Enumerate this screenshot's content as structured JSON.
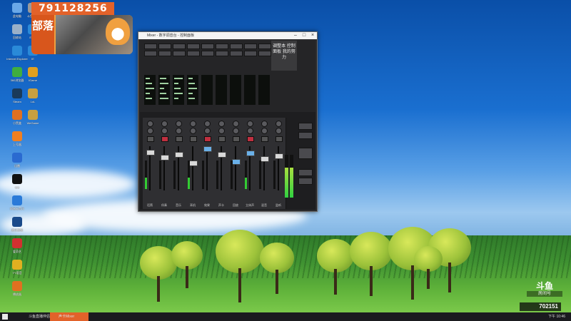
{
  "overlay": {
    "viewer_number": "791128256",
    "room_tag": "部落",
    "platform_logo": "斗鱼",
    "room_label": "房间号",
    "room_id": "702151"
  },
  "desktop_icons": [
    {
      "label": "此电脑",
      "icon": "computer-icon",
      "color": "#6aa8e8"
    },
    {
      "label": "回收站",
      "icon": "recycle-bin-icon",
      "color": "#9ab0c8"
    },
    {
      "label": "Internet Explorer",
      "icon": "ie-icon",
      "color": "#2a8ad8"
    },
    {
      "label": "360浏览器",
      "icon": "browser-icon",
      "color": "#3fae3f"
    },
    {
      "label": "Steam",
      "icon": "steam-icon",
      "color": "#1a3a5a"
    },
    {
      "label": "小黑盒",
      "icon": "app-icon",
      "color": "#e07020"
    },
    {
      "label": "上号器",
      "icon": "app-icon",
      "color": "#f07f20"
    },
    {
      "label": "迅雷",
      "icon": "app-icon",
      "color": "#2a6ad0"
    },
    {
      "label": "QQ",
      "icon": "qq-icon",
      "color": "#111"
    },
    {
      "label": "网易云音乐",
      "icon": "music-icon",
      "color": "#2a7ad8"
    },
    {
      "label": "腾讯视频",
      "icon": "video-icon",
      "color": "#1a4a8a"
    },
    {
      "label": "爱奇艺",
      "icon": "app-icon",
      "color": "#d03030"
    },
    {
      "label": "YY语音",
      "icon": "app-icon",
      "color": "#e0b020"
    },
    {
      "label": "播放器",
      "icon": "app-icon",
      "color": "#e07020"
    }
  ],
  "desktop_icons_col2": [
    {
      "label": "斗鱼直播",
      "icon": "app-icon",
      "color": "#999"
    },
    {
      "label": "Edge",
      "icon": "edge-icon",
      "color": "#2a8ad8"
    },
    {
      "label": "IE",
      "icon": "ie-icon",
      "color": "#2a8ad8"
    },
    {
      "label": "IGame",
      "icon": "game-icon",
      "color": "#e0a020"
    },
    {
      "label": "LoL",
      "icon": "game-icon",
      "color": "#c8a040"
    },
    {
      "label": "WeGame",
      "icon": "game-icon",
      "color": "#c8a040"
    }
  ],
  "mixer_window": {
    "title": "Mixer - 数字调音台 - 控制面板",
    "note": "调整本 控制面板 我的努力",
    "channels": [
      "话筒",
      "伴奏",
      "音乐",
      "耳机",
      "效果",
      "声卡",
      "回放",
      "立体声",
      "混音",
      "监听"
    ]
  },
  "taskbar": {
    "tasks": [
      "斗鱼直播伴侣",
      "声卡Mixer"
    ],
    "clock": "下午 10:46"
  }
}
